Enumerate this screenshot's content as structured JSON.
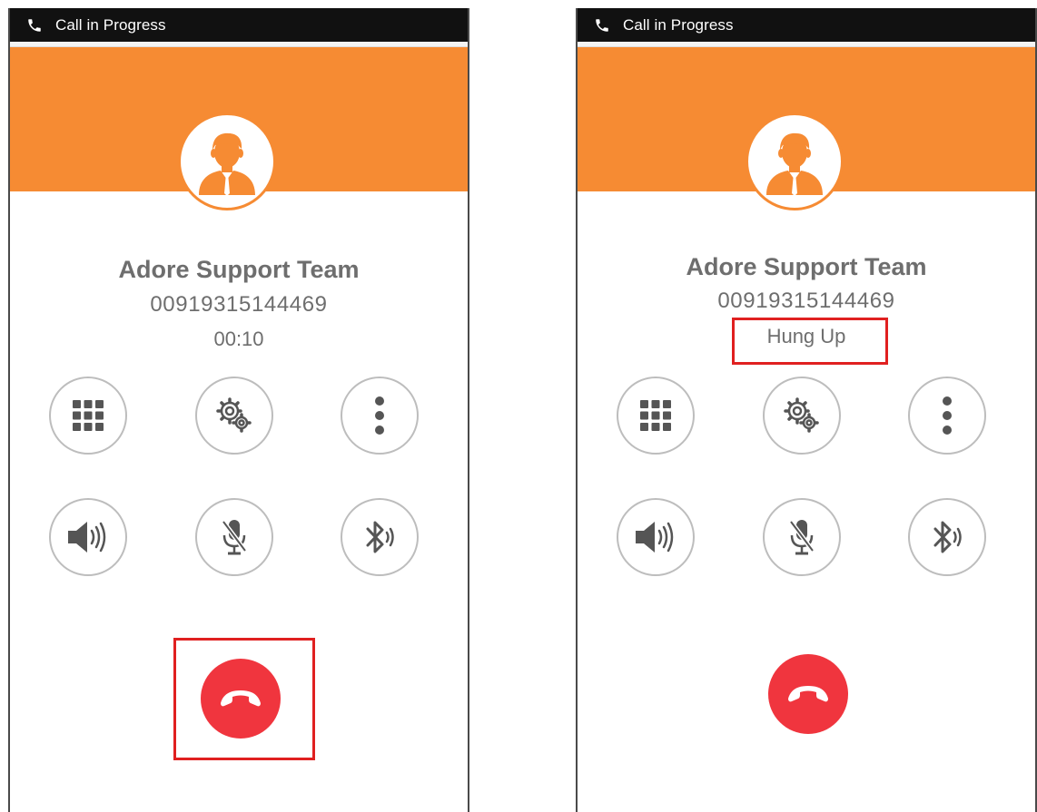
{
  "screens": [
    {
      "status_bar": {
        "text": "Call in Progress",
        "icon": "phone-icon"
      },
      "contact": {
        "name": "Adore Support Team",
        "number": "00919315144469"
      },
      "call_status": "00:10",
      "highlight": "end-call-button"
    },
    {
      "status_bar": {
        "text": "Call in Progress",
        "icon": "phone-icon"
      },
      "contact": {
        "name": "Adore Support Team",
        "number": "00919315144469"
      },
      "call_status": "Hung Up",
      "highlight": "call-status"
    }
  ],
  "controls": {
    "row1": [
      "dialpad-icon",
      "settings-gears-icon",
      "more-vertical-icon"
    ],
    "row2": [
      "speaker-icon",
      "mute-microphone-icon",
      "bluetooth-icon"
    ],
    "end_call": "hang-up-icon"
  },
  "colors": {
    "header": "#f68b33",
    "end_call": "#f0353e",
    "highlight": "#e02020",
    "status_bar": "#111111",
    "text": "#6e6e6e"
  }
}
